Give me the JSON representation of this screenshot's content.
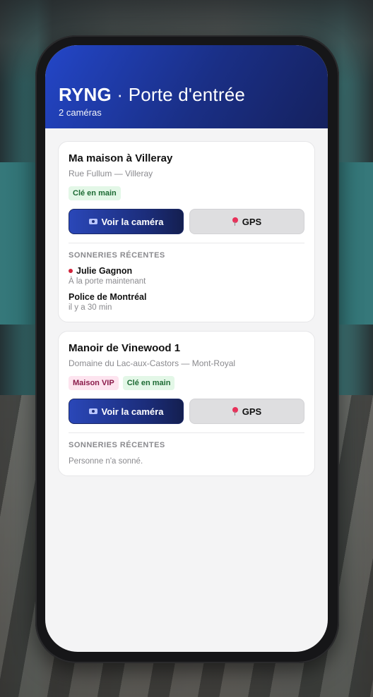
{
  "header": {
    "brand": "RYNG",
    "separator": "·",
    "page_title": "Porte d'entrée",
    "camera_count": "2 caméras"
  },
  "cards": [
    {
      "title": "Ma maison à Villeray",
      "address": "Rue Fullum — Villeray",
      "badges": [
        {
          "label": "Clé en main",
          "style": "green"
        }
      ],
      "camera_button": "Voir la caméra",
      "gps_button": "GPS",
      "section_label": "SONNERIES RÉCENTES",
      "rings": [
        {
          "name": "Julie Gagnon",
          "time": "À la porte maintenant",
          "live": true
        },
        {
          "name": "Police de Montréal",
          "time": "il y a 30 min",
          "live": false
        }
      ]
    },
    {
      "title": "Manoir de Vinewood 1",
      "address": "Domaine du Lac-aux-Castors — Mont-Royal",
      "badges": [
        {
          "label": "Maison VIP",
          "style": "pink"
        },
        {
          "label": "Clé en main",
          "style": "green"
        }
      ],
      "camera_button": "Voir la caméra",
      "gps_button": "GPS",
      "section_label": "SONNERIES RÉCENTES",
      "empty_note": "Personne n'a sonné."
    }
  ],
  "colors": {
    "header_gradient_start": "#2346c8",
    "header_gradient_end": "#15215e",
    "live_dot": "#d0243b",
    "badge_green_bg": "#e3f7e7",
    "badge_pink_bg": "#fde4ef"
  },
  "icons": {
    "camera": "camera-icon",
    "gps": "pin-icon",
    "live": "live-dot-icon"
  }
}
